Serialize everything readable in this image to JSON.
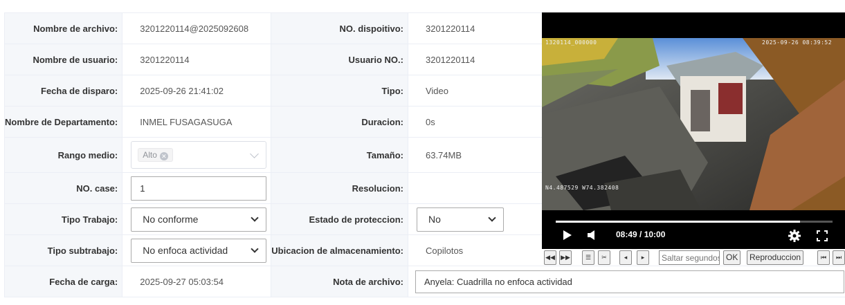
{
  "fields": {
    "filename_label": "Nombre de archivo:",
    "filename_value": "3201220114@2025092608",
    "device_no_label": "NO. dispoitivo:",
    "device_no_value": "3201220114",
    "username_label": "Nombre de usuario:",
    "username_value": "3201220114",
    "user_no_label": "Usuario NO.:",
    "user_no_value": "3201220114",
    "trigger_date_label": "Fecha de disparo:",
    "trigger_date_value": "2025-09-26 21:41:02",
    "type_label": "Tipo:",
    "type_value": "Video",
    "department_label": "Nombre de Departamento:",
    "department_value": "INMEL FUSAGASUGA",
    "duration_label": "Duracion:",
    "duration_value": "0s",
    "range_label": "Rango medio:",
    "range_tag": "Alto",
    "size_label": "Tamaño:",
    "size_value": "63.74MB",
    "case_no_label": "NO. case:",
    "case_no_value": "1",
    "resolution_label": "Resolucion:",
    "resolution_value": "",
    "work_type_label": "Tipo Trabajo:",
    "work_type_value": "No conforme",
    "protection_label": "Estado de proteccion:",
    "protection_value": "No",
    "work_subtype_label": "Tipo subtrabajo:",
    "work_subtype_value": "No enfoca actividad",
    "storage_label": "Ubicacion de almacenamiento:",
    "storage_value": "Copilotos",
    "upload_date_label": "Fecha de carga:",
    "upload_date_value": "2025-09-27 05:03:54",
    "note_label": "Nota de archivo:",
    "note_value": "Anyela: Cuadrilla no enfoca actividad"
  },
  "player": {
    "osd_top_left": "1320114_000000",
    "osd_top_right": "2025-09-26 08:39:52",
    "osd_coords": "N4.487529 W74.382408",
    "time_display": "08:49 / 10:00",
    "progress": 0.882,
    "play_icon": "play-icon",
    "volume_icon": "volume-icon",
    "settings_icon": "gear-icon",
    "fullscreen_icon": "fullscreen-icon"
  },
  "toolbar": {
    "seek_placeholder": "Saltar segundos",
    "ok_label": "OK",
    "playback_label": "Reproduccion"
  }
}
